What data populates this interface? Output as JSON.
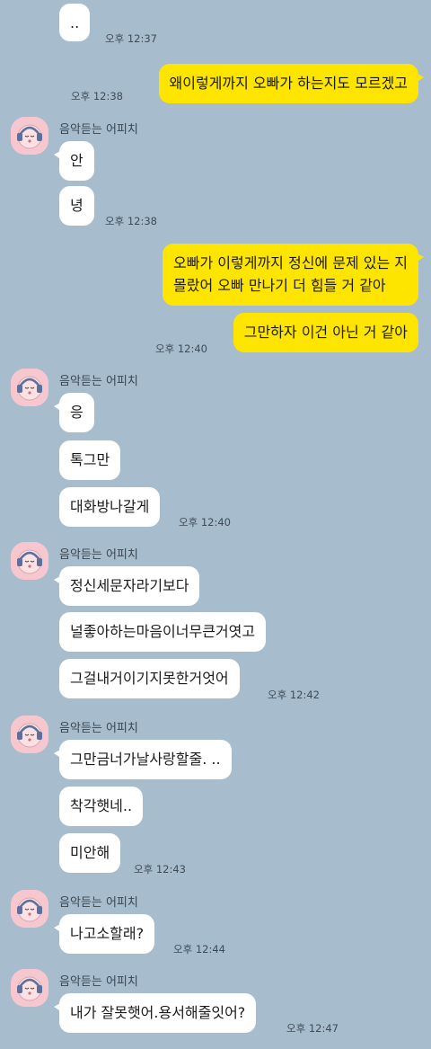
{
  "chat": {
    "contact_name": "음악듣는 어피치",
    "messages": [
      {
        "id": "m1",
        "from": "them",
        "text": "..",
        "time": "오후 12:37"
      },
      {
        "id": "m2",
        "from": "me",
        "text": "왜이렇게까지 오빠가 하는지도 모르겠고",
        "time": "오후 12:38"
      },
      {
        "id": "m3",
        "from": "them",
        "text": "안"
      },
      {
        "id": "m4",
        "from": "them",
        "text": "녕",
        "time": "오후 12:38"
      },
      {
        "id": "m5",
        "from": "me",
        "lines": [
          "오빠가 이렇게까지 정신에 문제 있는 지",
          "몰랐어 오빠 만나기 더 힘들 거 같아"
        ]
      },
      {
        "id": "m6",
        "from": "me",
        "text": "그만하자 이건 아닌 거 같아",
        "time": "오후 12:40"
      },
      {
        "id": "m7",
        "from": "them",
        "text": "응"
      },
      {
        "id": "m8",
        "from": "them",
        "text": "톡그만"
      },
      {
        "id": "m9",
        "from": "them",
        "text": "대화방나갈게",
        "time": "오후 12:40"
      },
      {
        "id": "m10",
        "from": "them",
        "text": "정신세문자라기보다"
      },
      {
        "id": "m11",
        "from": "them",
        "text": "널좋아하는마음이너무큰거엿고"
      },
      {
        "id": "m12",
        "from": "them",
        "text": "그걸내거이기지못한거엇어",
        "time": "오후 12:42"
      },
      {
        "id": "m13",
        "from": "them",
        "text": "그만금너가날사랑할줄. .."
      },
      {
        "id": "m14",
        "from": "them",
        "text": "착각햇네.."
      },
      {
        "id": "m15",
        "from": "them",
        "text": "미안해",
        "time": "오후 12:43"
      },
      {
        "id": "m16",
        "from": "them",
        "text": "나고소할래?",
        "time": "오후 12:44"
      },
      {
        "id": "m17",
        "from": "them",
        "text": "내가 잘못햇어.용서해줄잇어?",
        "time": "오후 12:47"
      }
    ]
  },
  "colors": {
    "background": "#a7bccd",
    "outgoing_bubble": "#fee500",
    "incoming_bubble": "#ffffff"
  },
  "icons": {
    "avatar": "apeach-with-headphones-avatar"
  }
}
